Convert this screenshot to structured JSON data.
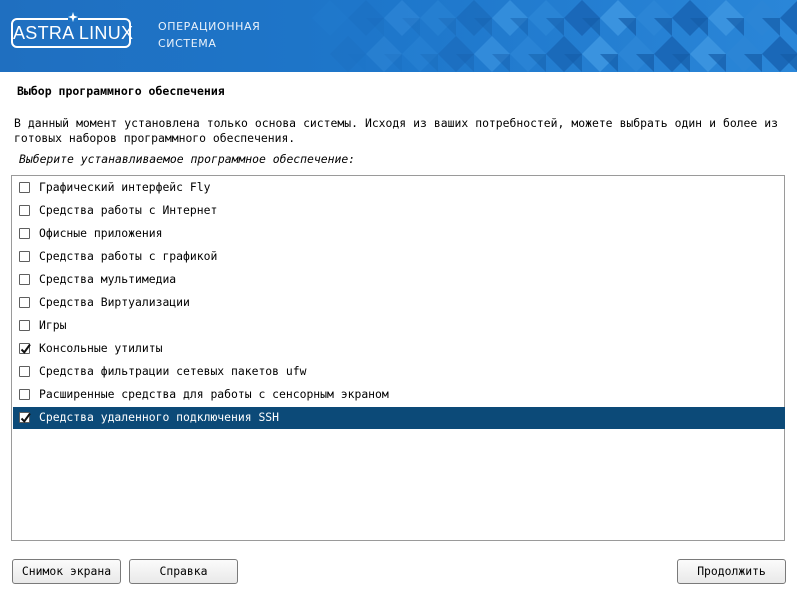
{
  "header": {
    "logo_text": "ASTRA LINUX",
    "subtitle_line1": "ОПЕРАЦИОННАЯ",
    "subtitle_line2": "СИСТЕМА"
  },
  "dialog": {
    "title": "Выбор программного обеспечения",
    "description": "В данный момент установлена только основа системы. Исходя из ваших потребностей, можете выбрать один и более из готовых наборов программного обеспечения.",
    "prompt": "Выберите устанавливаемое программное обеспечение:"
  },
  "software_list": [
    {
      "label": "Графический интерфейс Fly",
      "checked": false,
      "selected": false
    },
    {
      "label": "Средства работы с Интернет",
      "checked": false,
      "selected": false
    },
    {
      "label": "Офисные приложения",
      "checked": false,
      "selected": false
    },
    {
      "label": "Средства работы с графикой",
      "checked": false,
      "selected": false
    },
    {
      "label": "Средства мультимедиа",
      "checked": false,
      "selected": false
    },
    {
      "label": "Средства Виртуализации",
      "checked": false,
      "selected": false
    },
    {
      "label": "Игры",
      "checked": false,
      "selected": false
    },
    {
      "label": "Консольные утилиты",
      "checked": true,
      "selected": false
    },
    {
      "label": "Средства фильтрации сетевых пакетов ufw",
      "checked": false,
      "selected": false
    },
    {
      "label": "Расширенные средства для работы с сенсорным экраном",
      "checked": false,
      "selected": false
    },
    {
      "label": "Средства удаленного подключения SSH",
      "checked": true,
      "selected": true
    }
  ],
  "buttons": {
    "screenshot": "Снимок экрана",
    "help": "Справка",
    "continue": "Продолжить"
  },
  "colors": {
    "banner_blue": "#1e74c6",
    "selection": "#0c4a78"
  }
}
